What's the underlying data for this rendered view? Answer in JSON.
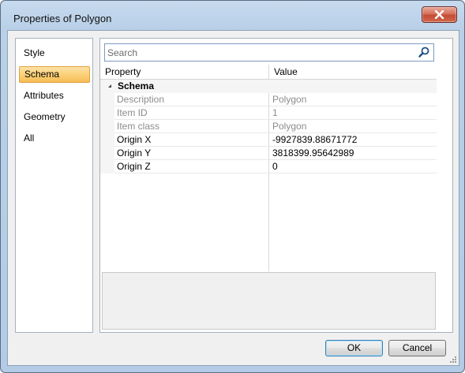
{
  "window": {
    "title": "Properties of Polygon"
  },
  "nav": {
    "items": [
      {
        "label": "Style",
        "selected": false
      },
      {
        "label": "Schema",
        "selected": true
      },
      {
        "label": "Attributes",
        "selected": false
      },
      {
        "label": "Geometry",
        "selected": false
      },
      {
        "label": "All",
        "selected": false
      }
    ]
  },
  "search": {
    "placeholder": "Search"
  },
  "grid": {
    "columns": {
      "property": "Property",
      "value": "Value"
    },
    "category": "Schema",
    "rows": [
      {
        "name": "Description",
        "value": "Polygon",
        "readonly": true
      },
      {
        "name": "Item ID",
        "value": "1",
        "readonly": true
      },
      {
        "name": "Item class",
        "value": "Polygon",
        "readonly": true
      },
      {
        "name": "Origin X",
        "value": "-9927839.88671772",
        "readonly": false
      },
      {
        "name": "Origin Y",
        "value": "3818399.95642989",
        "readonly": false
      },
      {
        "name": "Origin Z",
        "value": "0",
        "readonly": false
      }
    ]
  },
  "buttons": {
    "ok": "OK",
    "cancel": "Cancel"
  },
  "icons": {
    "close": "close-icon",
    "search": "search-icon",
    "expand": "collapse-triangle-icon"
  },
  "colors": {
    "selection": "#fbd17a",
    "title_bar": "#b9d0e8",
    "close": "#c44a34"
  }
}
